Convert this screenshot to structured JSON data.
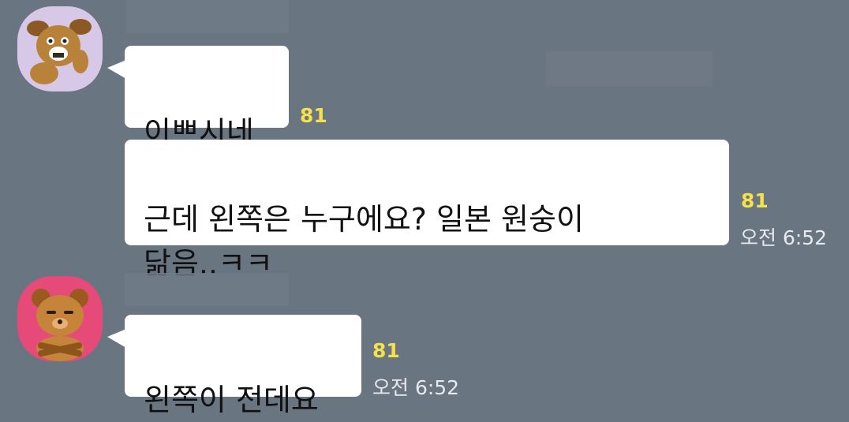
{
  "messages": [
    {
      "text": "이쁘시네",
      "unread": "81"
    },
    {
      "text": "근데 왼쪽은 누구에요? 일본 원숭이\n닮음..ㅋㅋ",
      "unread": "81",
      "time": "오전 6:52"
    },
    {
      "text": "왼쪽이 전데요",
      "unread": "81",
      "time": "오전 6:52"
    }
  ],
  "avatars": [
    {
      "icon": "dog-character-avatar-icon",
      "bg": "#d9c9e8"
    },
    {
      "icon": "bear-character-avatar-icon",
      "bg": "#e54a78"
    }
  ],
  "colors": {
    "background": "#6a7582",
    "bubble": "#ffffff",
    "unread": "#f5e14a"
  }
}
